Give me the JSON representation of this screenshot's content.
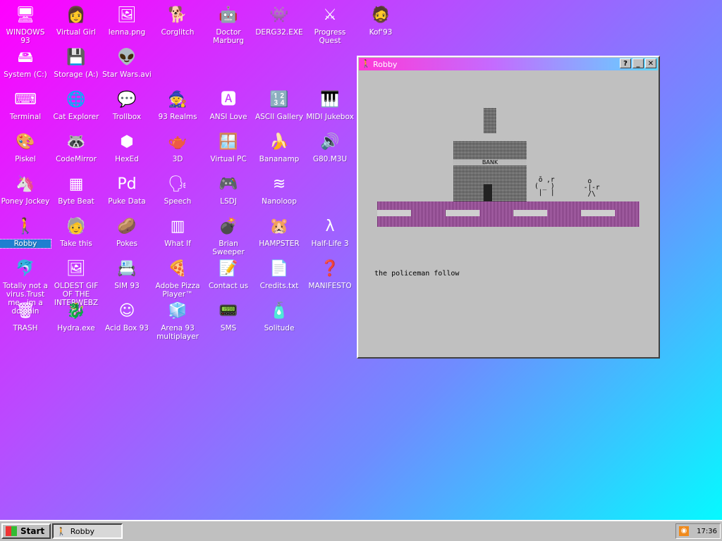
{
  "desktop": {
    "icons": [
      {
        "label": "WINDOWS 93",
        "glyph": "🖥",
        "icon": "computer-icon"
      },
      {
        "label": "Virtual Girl",
        "glyph": "👩",
        "icon": "virtual-girl-icon"
      },
      {
        "label": "lenna.png",
        "glyph": "🖼",
        "icon": "image-file-icon"
      },
      {
        "label": "Corglitch",
        "glyph": "🐕",
        "icon": "corgi-icon"
      },
      {
        "label": "Doctor Marburg",
        "glyph": "🤖",
        "icon": "doctor-icon"
      },
      {
        "label": "DERG32.EXE",
        "glyph": "👾",
        "icon": "derg-icon"
      },
      {
        "label": "Progress Quest",
        "glyph": "⚔",
        "icon": "swords-icon"
      },
      {
        "label": "Kof'93",
        "glyph": "🧔",
        "icon": "fighter-icon"
      },
      {
        "label": "System (C:)",
        "glyph": "🖴",
        "icon": "hard-drive-icon"
      },
      {
        "label": "Storage (A:)",
        "glyph": "💾",
        "icon": "floppy-icon"
      },
      {
        "label": "Star Wars.avi",
        "glyph": "👽",
        "icon": "yoda-icon"
      },
      {
        "label": "Terminal",
        "glyph": "⌨",
        "icon": "terminal-icon"
      },
      {
        "label": "Cat Explorer",
        "glyph": "🌐",
        "icon": "cat-explorer-icon"
      },
      {
        "label": "Trollbox",
        "glyph": "💬",
        "icon": "chat-icon"
      },
      {
        "label": "93 Realms",
        "glyph": "🧙",
        "icon": "realms-icon"
      },
      {
        "label": "ANSI Love",
        "glyph": "🅰",
        "icon": "ansi-icon"
      },
      {
        "label": "ASCII Gallery",
        "glyph": "🔢",
        "icon": "ascii-gallery-icon"
      },
      {
        "label": "MIDI Jukebox",
        "glyph": "🎹",
        "icon": "piano-icon"
      },
      {
        "label": "Piskel",
        "glyph": "🎨",
        "icon": "palette-icon"
      },
      {
        "label": "CodeMirror",
        "glyph": "🦝",
        "icon": "codemirror-icon"
      },
      {
        "label": "HexEd",
        "glyph": "⬢",
        "icon": "hex-editor-icon"
      },
      {
        "label": "3D",
        "glyph": "🫖",
        "icon": "teapot-icon"
      },
      {
        "label": "Virtual PC",
        "glyph": "🪟",
        "icon": "virtual-pc-icon"
      },
      {
        "label": "Bananamp",
        "glyph": "🍌",
        "icon": "banana-icon"
      },
      {
        "label": "G80.M3U",
        "glyph": "🔊",
        "icon": "playlist-icon"
      },
      {
        "label": "Poney Jockey",
        "glyph": "🦄",
        "icon": "pony-icon"
      },
      {
        "label": "Byte Beat",
        "glyph": "▦",
        "icon": "bytebeat-icon"
      },
      {
        "label": "Puke Data",
        "glyph": "Pd",
        "icon": "puredata-icon"
      },
      {
        "label": "Speech",
        "glyph": "🗣",
        "icon": "speech-icon"
      },
      {
        "label": "LSDJ",
        "glyph": "🎮",
        "icon": "lsdj-icon"
      },
      {
        "label": "Nanoloop",
        "glyph": "≋",
        "icon": "nanoloop-icon"
      },
      {
        "label": "Robby",
        "glyph": "🚶",
        "icon": "robby-icon"
      },
      {
        "label": "Take this",
        "glyph": "🧓",
        "icon": "take-this-icon"
      },
      {
        "label": "Pokes",
        "glyph": "🥔",
        "icon": "potato-icon"
      },
      {
        "label": "What If",
        "glyph": "▥",
        "icon": "what-if-icon"
      },
      {
        "label": "Brian Sweeper",
        "glyph": "💣",
        "icon": "mine-icon"
      },
      {
        "label": "HAMPSTER",
        "glyph": "🐹",
        "icon": "hamster-icon"
      },
      {
        "label": "Half-Life 3",
        "glyph": "λ",
        "icon": "half-life-icon"
      },
      {
        "label": "Totally not a virus.Trust me...im a dolphin",
        "glyph": "🐬",
        "icon": "dolphin-icon"
      },
      {
        "label": "OLDEST GIF OF THE INTERWEBZ gif",
        "glyph": "🖼",
        "icon": "gif-file-icon"
      },
      {
        "label": "SIM 93",
        "glyph": "📇",
        "icon": "sim-icon"
      },
      {
        "label": "Adobe Pizza Player™",
        "glyph": "🍕",
        "icon": "pizza-icon"
      },
      {
        "label": "Contact us",
        "glyph": "📝",
        "icon": "contact-icon"
      },
      {
        "label": "Credits.txt",
        "glyph": "📄",
        "icon": "text-file-icon"
      },
      {
        "label": "MANIFESTO",
        "glyph": "❓",
        "icon": "question-icon"
      },
      {
        "label": "TRASH",
        "glyph": "🗑",
        "icon": "trash-icon"
      },
      {
        "label": "Hydra.exe",
        "glyph": "🐉",
        "icon": "hydra-icon"
      },
      {
        "label": "Acid Box 93",
        "glyph": "☺",
        "icon": "smiley-icon"
      },
      {
        "label": "Arena 93 multiplayer",
        "glyph": "🧊",
        "icon": "cube-icon"
      },
      {
        "label": "SMS",
        "glyph": "📟",
        "icon": "sms-icon"
      },
      {
        "label": "Solitude",
        "glyph": "🧴",
        "icon": "solitude-icon"
      }
    ]
  },
  "window": {
    "title": "Robby",
    "help": "?",
    "minimize": "_",
    "close": "✕",
    "bank_label": "BANK",
    "robber_ascii": " ō ,r\n( _ )\n |  |",
    "police_ascii": "  o\n -|-r\n  /\\",
    "story_text": "the policeman follow"
  },
  "taskbar": {
    "start_label": "Start",
    "task_label": "Robby",
    "clock": "17:36"
  }
}
